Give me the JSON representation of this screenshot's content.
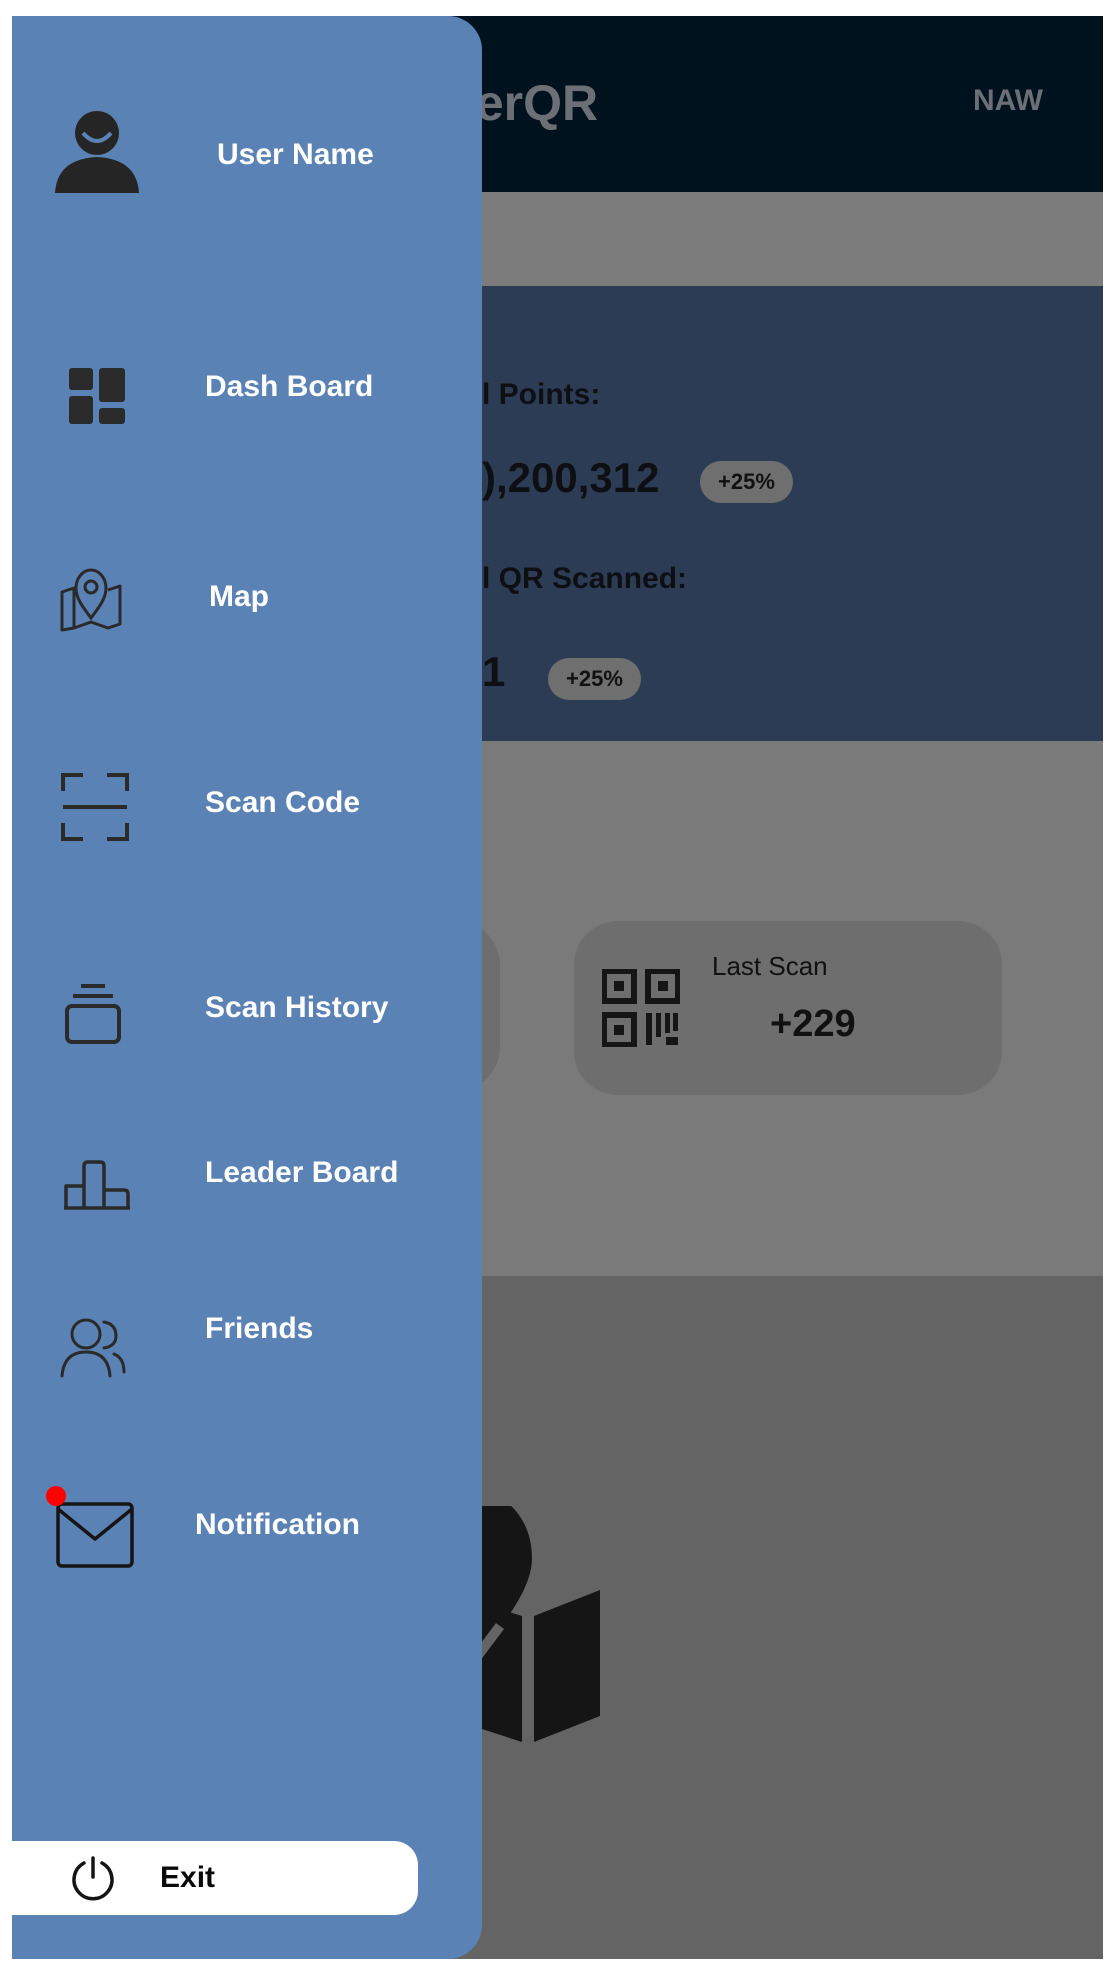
{
  "app": {
    "title": "ufferQR",
    "top_right_label": "NAW"
  },
  "stats": {
    "points_label": "l Points:",
    "points_value": "),200,312",
    "points_change": "+25%",
    "qr_label": "l QR Scanned:",
    "qr_value": "1",
    "qr_change": "+25%"
  },
  "cards": {
    "last_scan_label": "Last Scan",
    "last_scan_value": "+229"
  },
  "drawer": {
    "user_name": "User Name",
    "items": [
      {
        "label": "Dash Board",
        "icon": "dashboard-icon"
      },
      {
        "label": "Map",
        "icon": "map-pin-icon"
      },
      {
        "label": "Scan Code",
        "icon": "scan-frame-icon"
      },
      {
        "label": "Scan History",
        "icon": "history-stack-icon"
      },
      {
        "label": "Leader Board",
        "icon": "podium-icon"
      },
      {
        "label": "Friends",
        "icon": "friends-icon"
      },
      {
        "label": "Notification",
        "icon": "mail-icon"
      }
    ],
    "exit_label": "Exit"
  },
  "colors": {
    "drawer_bg": "#5b82b4",
    "topbar_bg": "#01121f",
    "stats_bg": "#2d3c55",
    "notification_dot": "#ff0000"
  }
}
